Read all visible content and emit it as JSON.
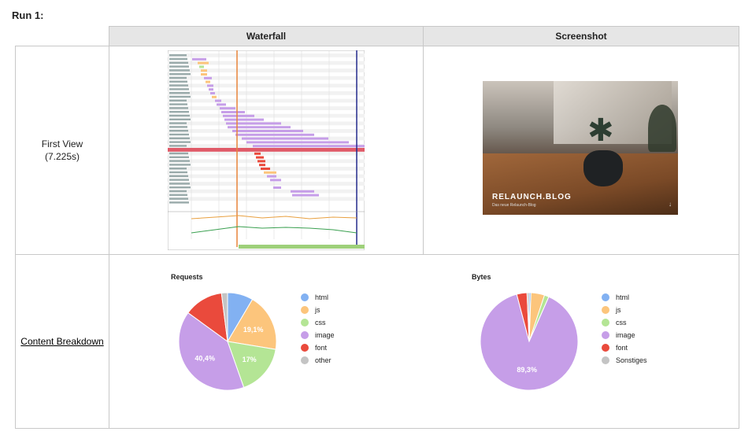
{
  "run_title": "Run 1:",
  "headers": {
    "waterfall": "Waterfall",
    "screenshot": "Screenshot"
  },
  "first_view": {
    "label": "First View",
    "time": "(7.225s)"
  },
  "content_breakdown": {
    "label": "Content Breakdown"
  },
  "screenshot": {
    "brand": "RELAUNCH.BLOG",
    "sub": "Das neue Relaunch-Blog"
  },
  "colors": {
    "html": "#82b1f2",
    "js": "#fcc57c",
    "css": "#b4e595",
    "image": "#c69ee8",
    "font": "#ea4a3c",
    "other": "#c4c4c4"
  },
  "chart_data": [
    {
      "type": "pie",
      "title": "Requests",
      "categories": [
        "html",
        "js",
        "css",
        "image",
        "font",
        "other"
      ],
      "values": [
        8.5,
        19.1,
        17,
        40.4,
        13,
        2
      ],
      "labels": [
        "",
        "19,1%",
        "17%",
        "40,4%",
        "",
        ""
      ]
    },
    {
      "type": "pie",
      "title": "Bytes",
      "categories": [
        "html",
        "js",
        "css",
        "image",
        "font",
        "Sonstiges"
      ],
      "values": [
        0.6,
        4.5,
        1.5,
        89.3,
        3.4,
        0.7
      ],
      "labels": [
        "",
        "",
        "",
        "89,3%",
        "",
        ""
      ]
    }
  ]
}
